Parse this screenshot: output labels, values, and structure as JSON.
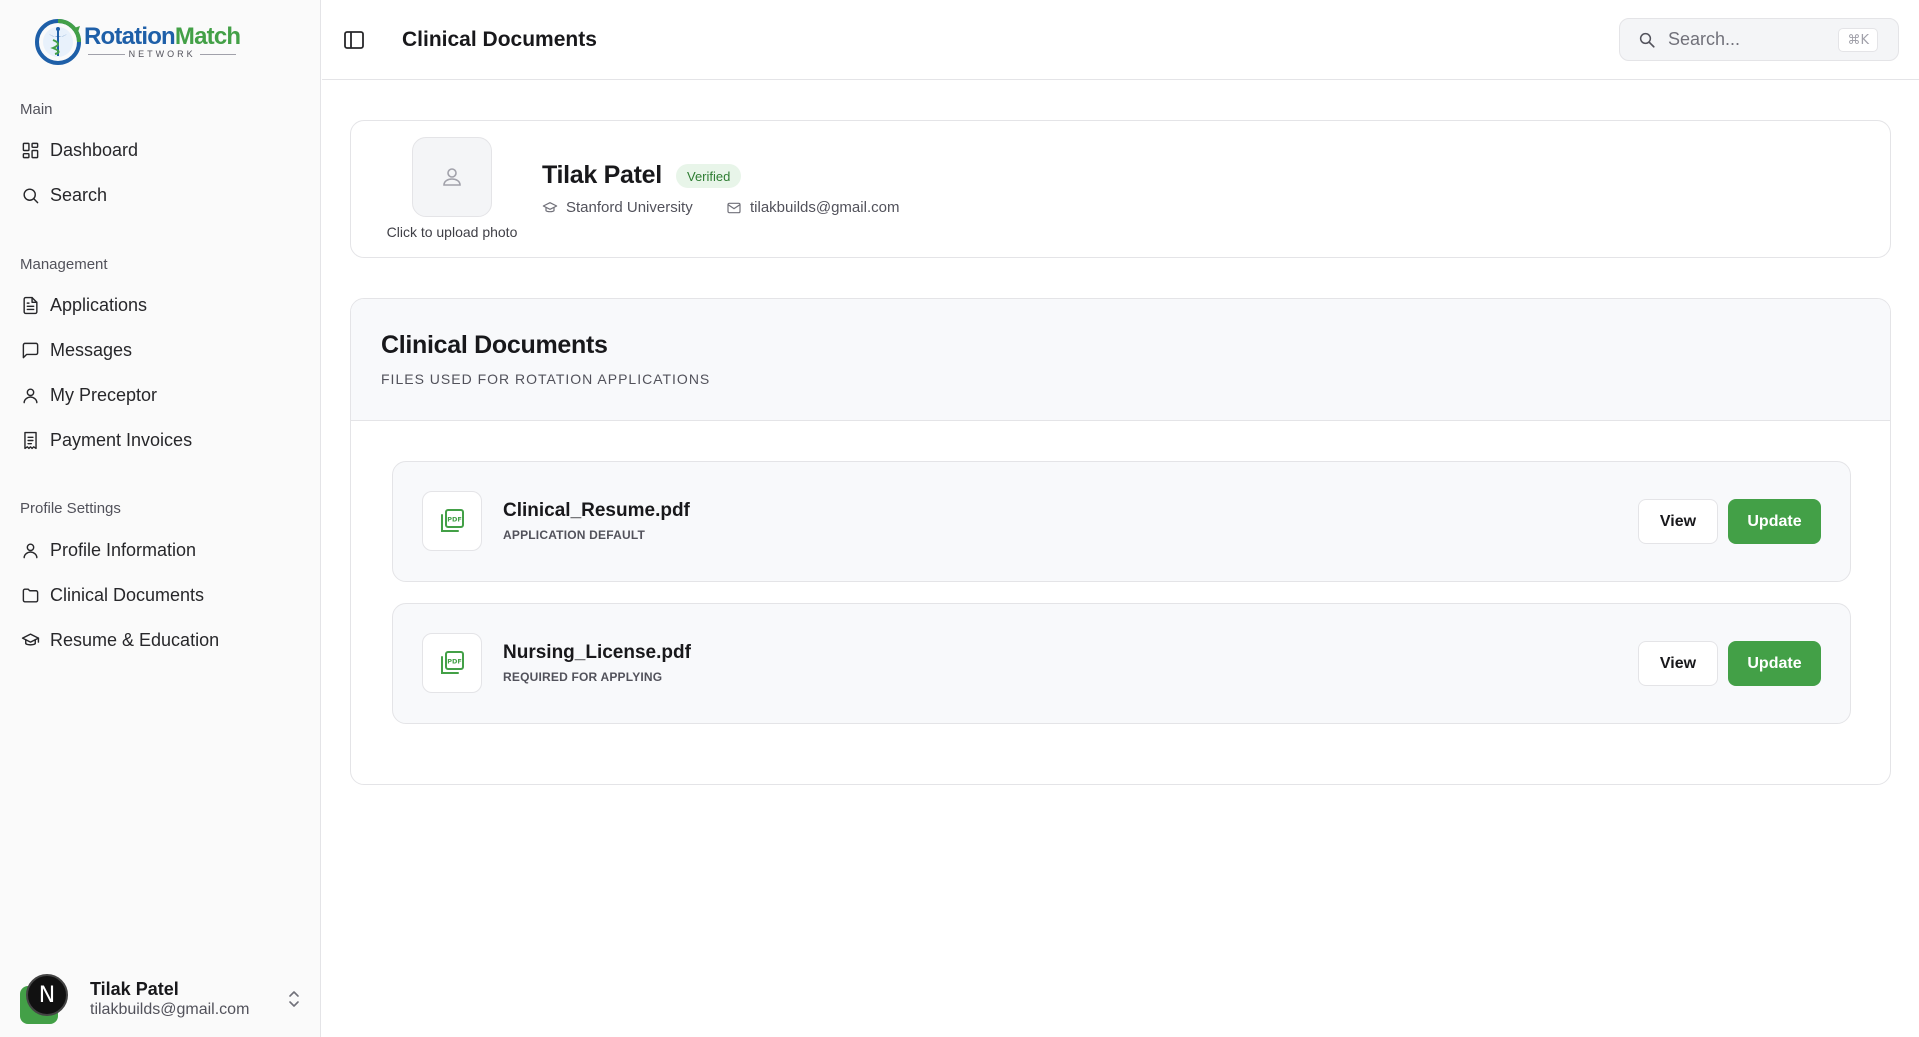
{
  "brand": {
    "name_part1": "Rotation",
    "name_part2": "Match",
    "tagline": "NETWORK",
    "primary_color": "#1e5fa8",
    "accent_color": "#43a047"
  },
  "sidebar": {
    "groups": [
      {
        "label": "Main",
        "items": [
          {
            "label": "Dashboard",
            "icon": "layout-grid-icon"
          },
          {
            "label": "Search",
            "icon": "search-icon"
          }
        ]
      },
      {
        "label": "Management",
        "items": [
          {
            "label": "Applications",
            "icon": "file-text-icon"
          },
          {
            "label": "Messages",
            "icon": "message-square-icon"
          },
          {
            "label": "My Preceptor",
            "icon": "user-icon"
          },
          {
            "label": "Payment Invoices",
            "icon": "receipt-icon"
          }
        ]
      },
      {
        "label": "Profile Settings",
        "items": [
          {
            "label": "Profile Information",
            "icon": "user-icon"
          },
          {
            "label": "Clinical Documents",
            "icon": "folder-icon"
          },
          {
            "label": "Resume & Education",
            "icon": "graduation-cap-icon"
          }
        ]
      }
    ],
    "user": {
      "avatar_letter": "N",
      "name": "Tilak Patel",
      "email": "tilakbuilds@gmail.com"
    }
  },
  "header": {
    "title": "Clinical Documents",
    "search_placeholder": "Search...",
    "search_shortcut": "⌘K"
  },
  "profile": {
    "upload_caption": "Click to upload photo",
    "name": "Tilak Patel",
    "badge": "Verified",
    "school": "Stanford University",
    "email": "tilakbuilds@gmail.com"
  },
  "documents": {
    "title": "Clinical Documents",
    "subtitle": "FILES USED FOR ROTATION APPLICATIONS",
    "files": [
      {
        "name": "Clinical_Resume.pdf",
        "tag": "APPLICATION DEFAULT",
        "view_label": "View",
        "update_label": "Update"
      },
      {
        "name": "Nursing_License.pdf",
        "tag": "REQUIRED FOR APPLYING",
        "view_label": "View",
        "update_label": "Update"
      }
    ]
  }
}
